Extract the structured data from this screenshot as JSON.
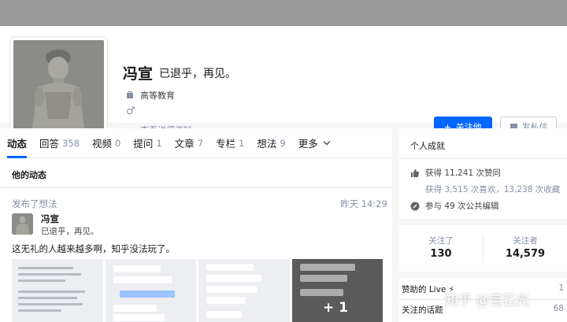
{
  "profile": {
    "name": "冯宣",
    "headline": "已退乎，再见。",
    "education": "高等教育",
    "gender_symbol": "♂",
    "view_more": "查看详细资料",
    "follow_label": "关注他",
    "message_label": "发私信"
  },
  "tabs": [
    {
      "label": "动态",
      "count": ""
    },
    {
      "label": "回答",
      "count": "358"
    },
    {
      "label": "视频",
      "count": "0"
    },
    {
      "label": "提问",
      "count": "1"
    },
    {
      "label": "文章",
      "count": "7"
    },
    {
      "label": "专栏",
      "count": "1"
    },
    {
      "label": "想法",
      "count": "9"
    },
    {
      "label": "更多",
      "count": ""
    }
  ],
  "feed": {
    "section_title": "他的动态",
    "action": "发布了想法",
    "time": "昨天 14:29",
    "author_name": "冯宣",
    "author_headline": "已退乎，再见。",
    "content": "这无礼的人越来越多啊，知乎没法玩了。",
    "more_images": "+ 1"
  },
  "achievements": {
    "title": "个人成就",
    "likes": "获得 11,241 次赞同",
    "likes_detail": "获得 3,515 次喜欢，13,238 次收藏",
    "edits": "参与 49 次公共编辑"
  },
  "follow_stats": {
    "following_label": "关注了",
    "following_count": "130",
    "followers_label": "关注者",
    "followers_count": "14,579"
  },
  "misc": {
    "live_label": "赞助的 Live ⚡",
    "live_count": "1",
    "topics_label": "关注的话题",
    "topics_count": "68"
  },
  "watermark": "知乎 @宝石光",
  "colors": {
    "accent": "#0066ff",
    "banner": "#9a9a9a",
    "muted": "#8590a6"
  }
}
